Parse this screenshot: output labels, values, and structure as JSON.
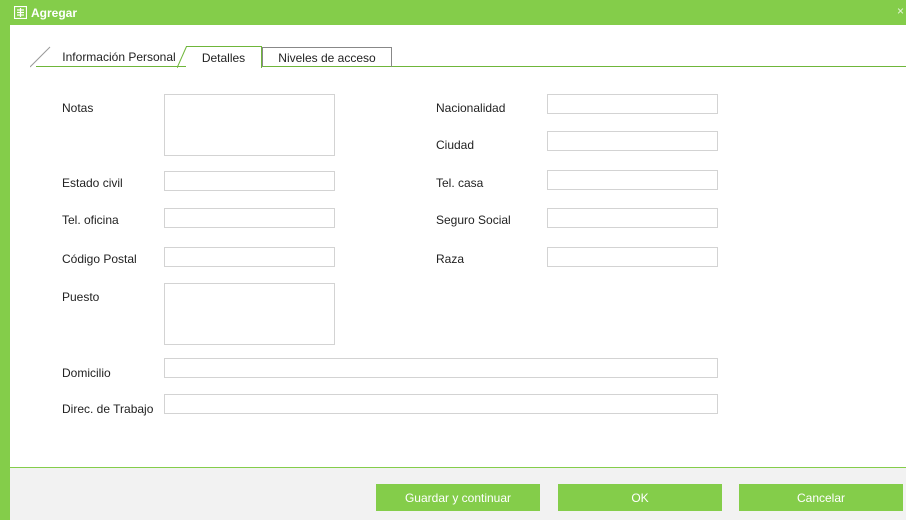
{
  "window": {
    "title": "Agregar",
    "close_glyph": "×",
    "icon": "add-form-icon"
  },
  "tabs": [
    {
      "label": "Información Personal"
    },
    {
      "label": "Detalles"
    },
    {
      "label": "Niveles de acceso"
    }
  ],
  "active_tab": "Detalles",
  "form": {
    "notas": {
      "label": "Notas",
      "value": ""
    },
    "estado_civil": {
      "label": "Estado civil",
      "value": ""
    },
    "tel_oficina": {
      "label": "Tel. oficina",
      "value": ""
    },
    "codigo_postal": {
      "label": "Código Postal",
      "value": ""
    },
    "puesto": {
      "label": "Puesto",
      "value": ""
    },
    "domicilio": {
      "label": "Domicilio",
      "value": ""
    },
    "direc_trabajo": {
      "label": "Direc. de Trabajo",
      "value": ""
    },
    "nacionalidad": {
      "label": "Nacionalidad",
      "value": ""
    },
    "ciudad": {
      "label": "Ciudad",
      "value": ""
    },
    "tel_casa": {
      "label": "Tel. casa",
      "value": ""
    },
    "seguro_social": {
      "label": "Seguro Social",
      "value": ""
    },
    "raza": {
      "label": "Raza",
      "value": ""
    }
  },
  "buttons": {
    "save_continue": "Guardar y continuar",
    "ok": "OK",
    "cancel": "Cancelar"
  },
  "colors": {
    "accent": "#84cd4a",
    "footer_bg": "#f2f2f2",
    "field_border": "#d3d3d3"
  }
}
